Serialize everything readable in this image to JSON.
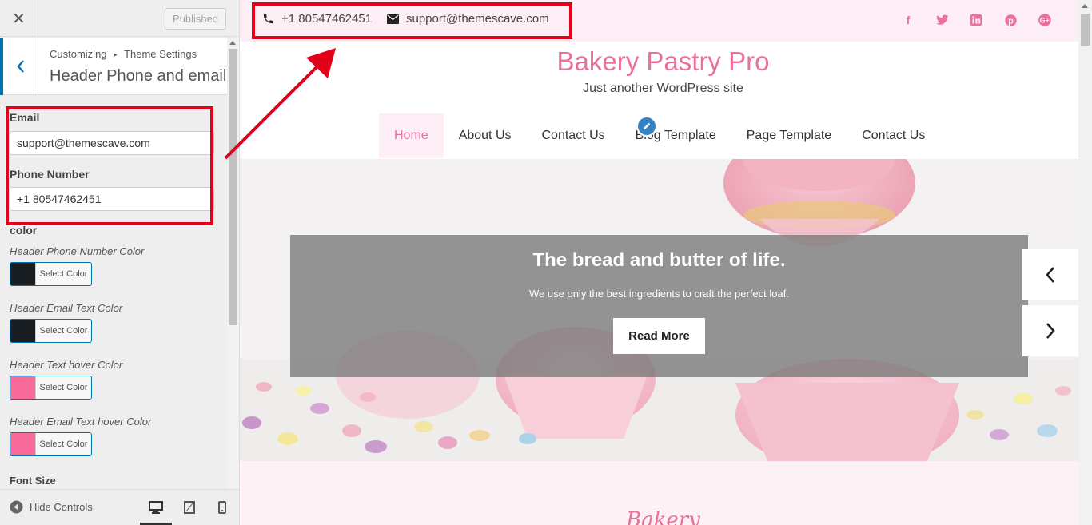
{
  "sidebar": {
    "close_icon": "close-icon",
    "publish_label": "Published",
    "breadcrumb_root": "Customizing",
    "breadcrumb_sep": "▸",
    "breadcrumb_section": "Theme Settings",
    "section_title": "Header Phone and email",
    "email_label": "Email",
    "email_value": "support@themescave.com",
    "phone_label": "Phone Number",
    "phone_value": "+1 80547462451",
    "color_heading": "color",
    "colors": [
      {
        "label": "Header Phone Number Color",
        "button": "Select Color",
        "swatch": "#191e23"
      },
      {
        "label": "Header Email Text Color",
        "button": "Select Color",
        "swatch": "#191e23"
      },
      {
        "label": "Header Text hover Color",
        "button": "Select Color",
        "swatch": "#f86b9a"
      },
      {
        "label": "Header Email Text hover Color",
        "button": "Select Color",
        "swatch": "#f86b9a"
      }
    ],
    "font_size_label": "Font Size",
    "hide_controls": "Hide Controls",
    "devices": [
      "desktop-icon",
      "tablet-icon",
      "mobile-icon"
    ]
  },
  "preview": {
    "phone": "+1 80547462451",
    "email": "support@themescave.com",
    "social": [
      "facebook-icon",
      "twitter-icon",
      "linkedin-icon",
      "pinterest-icon",
      "google-plus-icon"
    ],
    "site_title": "Bakery Pastry Pro",
    "tagline": "Just another WordPress site",
    "nav": [
      "Home",
      "About Us",
      "Contact Us",
      "Blog Template",
      "Page Template",
      "Contact Us"
    ],
    "active_nav": "Home",
    "hero_title": "The bread and butter of life.",
    "hero_text": "We use only the best ingredients to craft the perfect loaf.",
    "hero_button": "Read More",
    "section_word": "Bakery"
  },
  "colors": {
    "accent_pink": "#e8709a",
    "topbar_bg": "#fdeef5",
    "highlight_red": "#e3001b",
    "wp_blue": "#0073aa"
  }
}
